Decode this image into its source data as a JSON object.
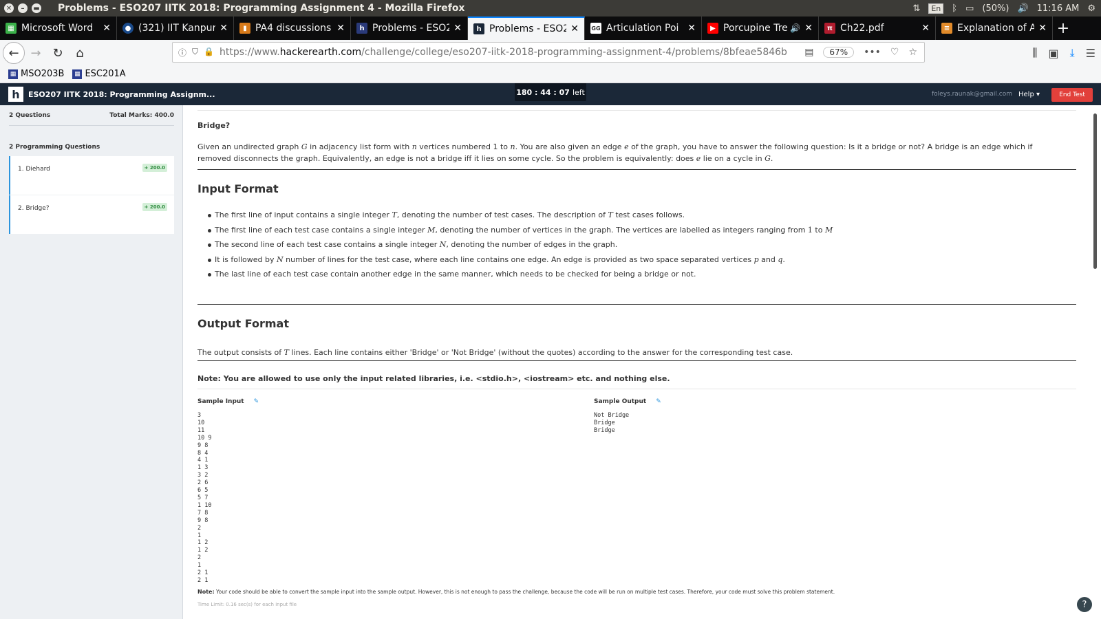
{
  "os": {
    "window_title": "Problems - ESO207 IITK 2018: Programming Assignment 4 - Mozilla Firefox",
    "keyboard": "En",
    "battery": "(50%)",
    "clock": "11:16 AM"
  },
  "tabs": [
    {
      "label": "Microsoft Word",
      "favicon_color": "#3bb14a"
    },
    {
      "label": "(321) IIT Kanpur",
      "favicon_color": "#1a4a8a"
    },
    {
      "label": "PA4 discussions",
      "favicon_color": "#d87a1a"
    },
    {
      "label": "Problems - ESO2",
      "favicon_color": "#2a3a7a"
    },
    {
      "label": "Problems - ESO2",
      "favicon_color": "#2a3a7a",
      "active": true
    },
    {
      "label": "Articulation Poi",
      "favicon_color": "#ffffff"
    },
    {
      "label": "Porcupine Tre",
      "favicon_color": "#ff0000"
    },
    {
      "label": "Ch22.pdf",
      "favicon_color": "#b01c2e"
    },
    {
      "label": "Explanation of A",
      "favicon_color": "#e28b2a"
    }
  ],
  "navbar": {
    "url_prefix": "https://www.",
    "url_host": "hackerearth.com",
    "url_path": "/challenge/college/eso207-iitk-2018-programming-assignment-4/problems/8bfeae5846b",
    "zoom": "67%"
  },
  "bookmarks": [
    {
      "label": "MSO203B"
    },
    {
      "label": "ESC201A"
    }
  ],
  "app_header": {
    "title": "ESO207 IITK 2018: Programming Assignm...",
    "timer_value": "180 : 44 : 07",
    "timer_suffix": "left",
    "email": "foleys.raunak@gmail.com",
    "help_label": "Help ▾",
    "end_test_label": "End Test"
  },
  "sidebar": {
    "questions_count": "2 Questions",
    "total_marks": "Total Marks: 400.0",
    "section_label": "2 Programming Questions",
    "items": [
      {
        "label": "1. Diehard",
        "marks": "+ 200.0"
      },
      {
        "label": "2. Bridge?",
        "marks": "+ 200.0"
      }
    ]
  },
  "problem": {
    "title": "Bridge?",
    "desc_1": "Given an undirected graph",
    "G": "G",
    "desc_2": "in adjacency list form with",
    "n": "n",
    "desc_3": "vertices numbered 1 to",
    "desc_4": ". You are also given an edge",
    "e": "e",
    "desc_5": "of the graph, you have to answer the following question: Is it a bridge or not? A bridge is an edge which if removed disconnects the graph. Equivalently, an edge is not a bridge iff it lies on some cycle. So the problem is equivalently: does",
    "desc_6": "lie on a cycle in",
    "desc_7": ".",
    "input_heading": "Input Format",
    "bullet_1a": "The first line of input contains a single integer",
    "T": "T",
    "bullet_1b": ", denoting the number of test cases. The description of",
    "bullet_1c": "test cases follows.",
    "bullet_2a": "The first line of each test case contains a single integer",
    "M": "M",
    "bullet_2b": ", denoting the number of vertices in the graph. The vertices are labelled as integers ranging from",
    "one": "1",
    "to": "to",
    "bullet_3a": "The second line of each test case contains a single integer",
    "N": "N",
    "bullet_3b": ", denoting the number of edges in the graph.",
    "bullet_4a": "It is followed by",
    "bullet_4b": "number of lines for the test case, where each line contains one edge. An edge is provided as two space separated vertices",
    "p": "p",
    "and": "and",
    "q": "q",
    "period": ".",
    "bullet_5": "The last line of each test case contain another edge in the same manner, which needs to be checked for being a bridge or not.",
    "output_heading": "Output Format",
    "output_a": "The output consists of",
    "output_b": "lines. Each line contains either 'Bridge' or 'Not Bridge' (without the quotes) according to the answer for the corresponding test case.",
    "note_libs": "Note: You are allowed to use only the input related libraries, i.e. <stdio.h>, <iostream> etc. and nothing else.",
    "sample_input_label": "Sample Input",
    "sample_output_label": "Sample Output",
    "sample_input": "3\n10\n11\n10 9\n9 8\n8 4\n4 1\n1 3\n3 2\n2 6\n6 5\n5 7\n1 10\n7 8\n9 8\n2\n1\n1 2\n1 2\n2\n1\n2 1\n2 1",
    "sample_output": "Not Bridge\nBridge\nBridge",
    "small_note_label": "Note:",
    "small_note": "Your code should be able to convert the sample input into the sample output. However, this is not enough to pass the challenge, because the code will be run on multiple test cases. Therefore, your code must solve this problem statement.",
    "time_limit": "Time Limit: 0.16 sec(s) for each input file"
  }
}
